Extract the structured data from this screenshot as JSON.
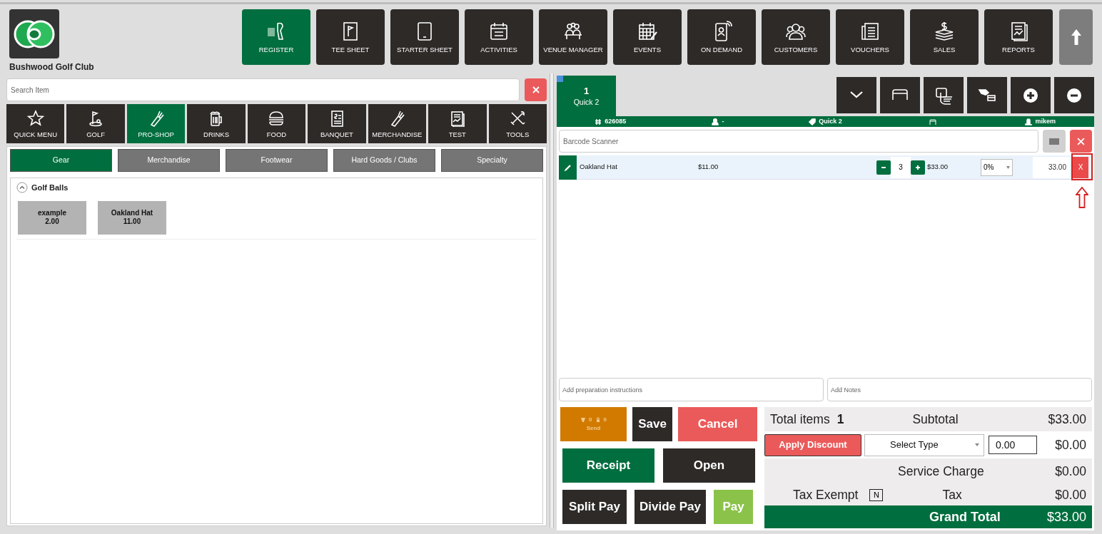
{
  "club_name": "Bushwood Golf Club",
  "nav": [
    {
      "label": "REGISTER",
      "selected": true
    },
    {
      "label": "TEE SHEET",
      "selected": false
    },
    {
      "label": "STARTER SHEET",
      "selected": false
    },
    {
      "label": "ACTIVITIES",
      "selected": false
    },
    {
      "label": "VENUE MANAGER",
      "selected": false
    },
    {
      "label": "EVENTS",
      "selected": false
    },
    {
      "label": "ON DEMAND",
      "selected": false
    },
    {
      "label": "CUSTOMERS",
      "selected": false
    },
    {
      "label": "VOUCHERS",
      "selected": false
    },
    {
      "label": "SALES",
      "selected": false
    },
    {
      "label": "REPORTS",
      "selected": false
    }
  ],
  "search": {
    "placeholder": "Search Item"
  },
  "categories": [
    {
      "label": "QUICK MENU",
      "selected": false
    },
    {
      "label": "GOLF",
      "selected": false
    },
    {
      "label": "PRO-SHOP",
      "selected": true
    },
    {
      "label": "DRINKS",
      "selected": false
    },
    {
      "label": "FOOD",
      "selected": false
    },
    {
      "label": "BANQUET",
      "selected": false
    },
    {
      "label": "MERCHANDISE",
      "selected": false
    },
    {
      "label": "TEST",
      "selected": false
    },
    {
      "label": "TOOLS",
      "selected": false
    }
  ],
  "subcategories": [
    {
      "label": "Gear",
      "selected": true
    },
    {
      "label": "Merchandise",
      "selected": false
    },
    {
      "label": "Footwear",
      "selected": false
    },
    {
      "label": "Hard Goods / Clubs",
      "selected": false
    },
    {
      "label": "Specialty",
      "selected": false
    }
  ],
  "group": {
    "title": "Golf Balls",
    "expanded": true,
    "items": [
      {
        "name": "example",
        "price": "2.00"
      },
      {
        "name": "Oakland Hat",
        "price": "11.00"
      }
    ]
  },
  "order_tabs": [
    {
      "number": "1",
      "label": "Quick 2",
      "selected": true
    }
  ],
  "order_info": {
    "number": "626085",
    "customer": "-",
    "name": "Quick 2",
    "user": "mikem"
  },
  "barcode": {
    "placeholder": "Barcode Scanner"
  },
  "lines": [
    {
      "name": "Oakland Hat",
      "price": "$11.00",
      "quantity": "3",
      "total": "$33.00",
      "discount": "0%",
      "amount": "33.00",
      "remove": "X",
      "highlighted": true
    }
  ],
  "preparation": {
    "placeholder": "Add preparation instructions"
  },
  "notes": {
    "placeholder": "Add Notes"
  },
  "action_rows": [
    [
      {
        "kind": "send",
        "label": "Send",
        "counts": [
          "0",
          "0"
        ]
      },
      {
        "kind": "dark",
        "label": "Save"
      },
      {
        "kind": "danger",
        "label": "Cancel"
      }
    ],
    [
      {
        "kind": "primary",
        "label": "Receipt"
      },
      {
        "kind": "dark",
        "label": "Open"
      }
    ],
    [
      {
        "kind": "dark",
        "label": "Split Pay"
      },
      {
        "kind": "dark",
        "label": "Divide Pay"
      },
      {
        "kind": "success",
        "label": "Pay"
      }
    ]
  ],
  "summary": {
    "total_items_label": "Total items",
    "total_items": "1",
    "subtotal_label": "Subtotal",
    "subtotal": "$33.00",
    "discount_button": "Apply Discount",
    "discount_type": "Select Type",
    "discount_value": "0.00",
    "discount": "$0.00",
    "service_charge_label": "Service Charge",
    "service_charge": "$0.00",
    "tax_exempt_label": "Tax Exempt",
    "tax_exempt": "N",
    "tax_label": "Tax",
    "tax": "$0.00",
    "grand_total_label": "Grand Total",
    "grand_total": "$33.00"
  }
}
